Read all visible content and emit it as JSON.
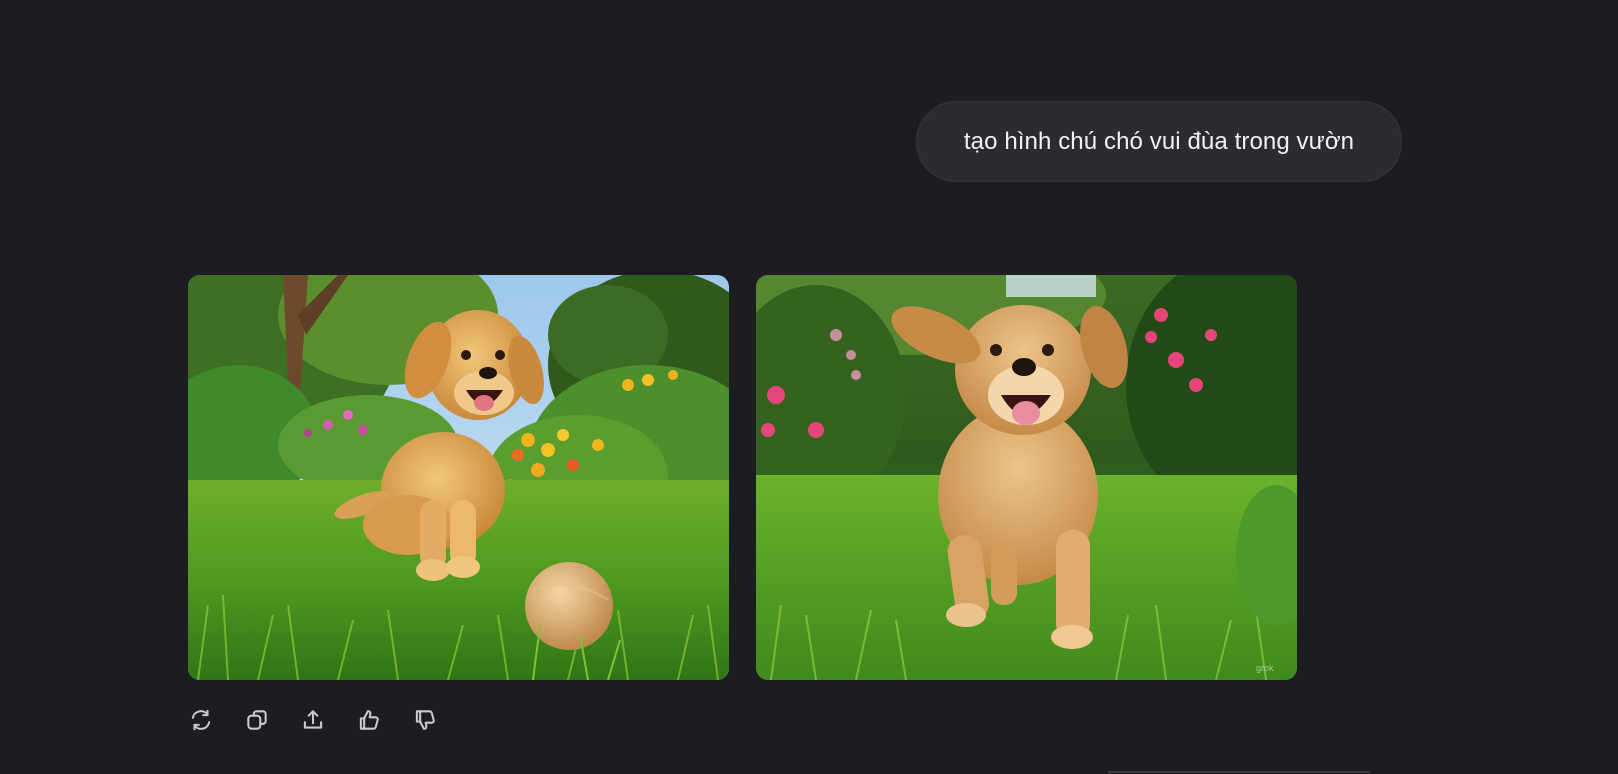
{
  "conversation": {
    "user_message": "tạo hình chú chó vui đùa trong vườn"
  },
  "response": {
    "images": [
      {
        "description_icon": "golden-retriever-puppy-with-ball-image"
      },
      {
        "description_icon": "golden-retriever-running-image"
      }
    ]
  },
  "actions": [
    {
      "icon": "regenerate-icon"
    },
    {
      "icon": "copy-icon"
    },
    {
      "icon": "share-icon"
    },
    {
      "icon": "thumbs-up-icon"
    },
    {
      "icon": "thumbs-down-icon"
    }
  ],
  "colors": {
    "background": "#1c1d20",
    "bubble": "#2b2c30",
    "icon": "#c9cacd"
  }
}
